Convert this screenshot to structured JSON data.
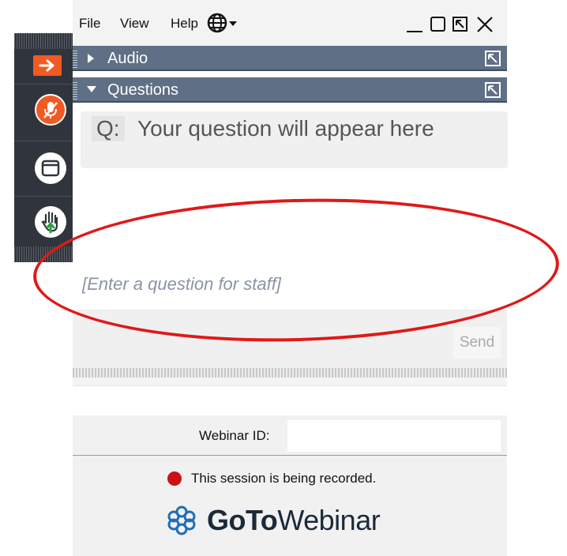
{
  "menu": {
    "file": "File",
    "view": "View",
    "help": "Help"
  },
  "window_controls": [
    "minimize",
    "maximize",
    "popout",
    "close"
  ],
  "sections": {
    "audio": {
      "title": "Audio",
      "expanded": false
    },
    "questions": {
      "title": "Questions",
      "expanded": true
    }
  },
  "questions_panel": {
    "q_label": "Q:",
    "display_text": "Your question will appear here",
    "input_placeholder": "[Enter a question for staff]",
    "send_label": "Send"
  },
  "footer": {
    "webinar_id_label": "Webinar ID:",
    "webinar_id_value": "",
    "recording_text": "This session is being recorded.",
    "logo_bold": "GoTo",
    "logo_light": "Webinar"
  },
  "rail_icons": [
    "arrow-right-icon",
    "mic-muted-icon",
    "window-icon",
    "raise-hand-icon"
  ],
  "colors": {
    "accent_orange": "#f15a24",
    "section_header": "#5e6f86",
    "rail_bg": "#30353d",
    "recording_red": "#cc1111",
    "annotation_red": "#e01919"
  }
}
